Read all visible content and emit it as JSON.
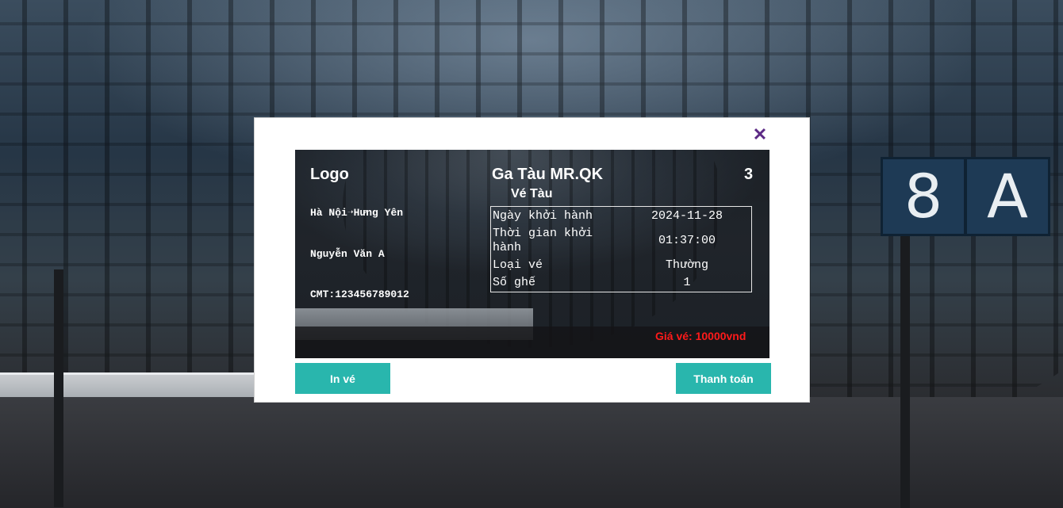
{
  "background": {
    "sign_number": "8",
    "sign_letter": "A"
  },
  "modal": {
    "close_icon": "close-icon",
    "close_glyph": "✕",
    "accent_color": "#5c2a85"
  },
  "ticket": {
    "logo": "Logo",
    "station_name": "Ga Tàu MR.QK",
    "ticket_number": "3",
    "title": "Vé Tàu",
    "route": "Hà Nội➝Hưng Yên",
    "passenger_name": "Nguyễn Văn A",
    "id_card": "CMT:123456789012",
    "details": [
      {
        "label": "Ngày khởi hành",
        "value": "2024-11-28"
      },
      {
        "label": "Thời gian khởi hành",
        "value": "01:37:00"
      },
      {
        "label": "Loại vé",
        "value": "Thường"
      },
      {
        "label": "Số ghế",
        "value": "1"
      }
    ],
    "price": "Giá vé: 10000vnd",
    "price_color": "#ff1a1a"
  },
  "buttons": {
    "print_label": "In vé",
    "pay_label": "Thanh toán",
    "color": "#29b6ad"
  }
}
